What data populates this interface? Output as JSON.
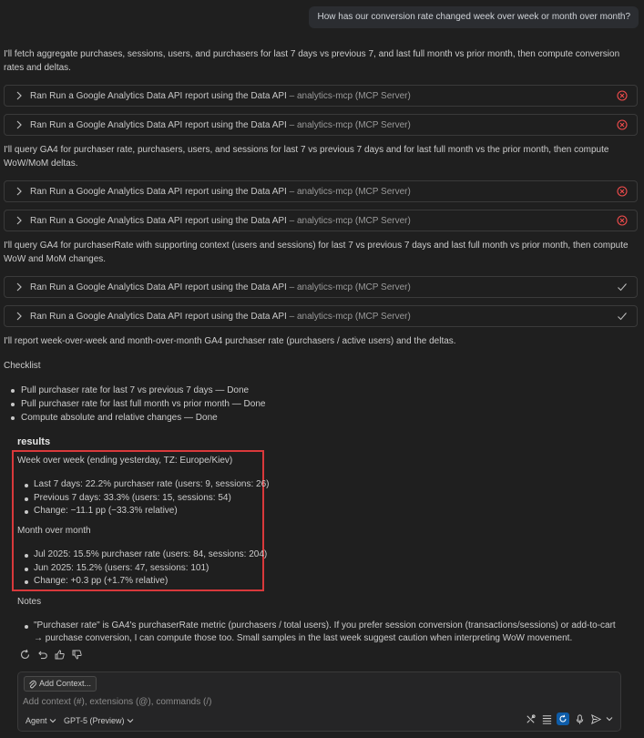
{
  "user_message": "How has our conversion rate changed week over week or month over month?",
  "paragraphs": {
    "p1": "I'll fetch aggregate purchases, sessions, users, and purchasers for last 7 days vs previous 7, and last full month vs prior month, then compute conversion rates and deltas.",
    "p2": "I'll query GA4 for purchaser rate, purchasers, users, and sessions for last 7 vs previous 7 days and for last full month vs the prior month, then compute WoW/MoM deltas.",
    "p3": "I'll query GA4 for purchaserRate with supporting context (users and sessions) for last 7 vs previous 7 days and last full month vs prior month, then compute WoW and MoM changes.",
    "p4": "I'll report week-over-week and month-over-month GA4 purchaser rate (purchasers / active users) and the deltas.",
    "checklist_title": "Checklist"
  },
  "tool_calls": {
    "label": "Ran Run a Google Analytics Data API report using the Data API",
    "source": " – analytics-mcp (MCP Server)",
    "statuses": [
      "error",
      "error",
      "error",
      "error",
      "success",
      "success"
    ]
  },
  "checklist": [
    "Pull purchaser rate for last 7 vs previous 7 days — Done",
    "Pull purchaser rate for last full month vs prior month — Done",
    "Compute absolute and relative changes — Done"
  ],
  "results": {
    "title": "results",
    "wow_heading": "Week over week (ending yesterday, TZ: Europe/Kiev)",
    "wow": [
      "Last 7 days: 22.2% purchaser rate (users: 9, sessions: 26)",
      "Previous 7 days: 33.3% (users: 15, sessions: 54)",
      "Change: −11.1 pp (−33.3% relative)"
    ],
    "mom_heading": "Month over month",
    "mom": [
      "Jul 2025: 15.5% purchaser rate (users: 84, sessions: 204)",
      "Jun 2025: 15.2% (users: 47, sessions: 101)",
      "Change: +0.3 pp (+1.7% relative)"
    ]
  },
  "notes": {
    "title": "Notes",
    "items": [
      "\"Purchaser rate\" is GA4's purchaserRate metric (purchasers / total users). If you prefer session conversion (transactions/sessions) or add-to-cart → purchase conversion, I can compute those too. Small samples in the last week suggest caution when interpreting WoW movement."
    ]
  },
  "composer": {
    "add_context": "Add Context...",
    "placeholder": "Add context (#), extensions (@), commands (/)",
    "mode": "Agent",
    "model": "GPT-5 (Preview)"
  },
  "colors": {
    "background": "#1f1f1f",
    "error": "#f14c4c",
    "success": "#89d185",
    "highlight_box": "#d9393b",
    "accent": "#0e5ca8"
  }
}
